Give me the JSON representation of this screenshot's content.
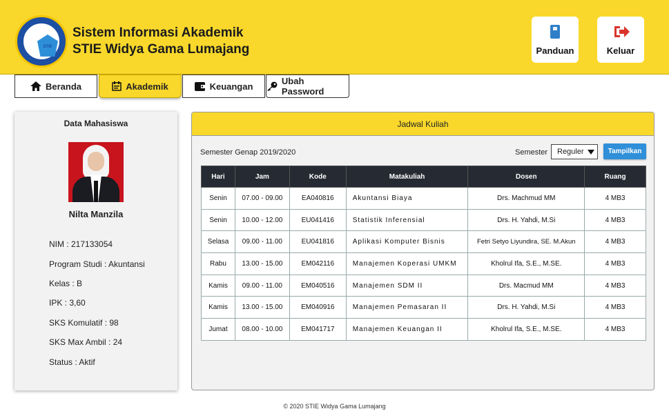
{
  "header": {
    "title_line1": "Sistem Informasi Akademik",
    "title_line2": "STIE Widya Gama Lumajang",
    "logo_text": "STIE",
    "buttons": [
      {
        "label": "Panduan",
        "icon": "book-icon"
      },
      {
        "label": "Keluar",
        "icon": "sign-out-icon"
      }
    ]
  },
  "nav": {
    "tabs": [
      {
        "label": "Beranda",
        "icon": "home-icon",
        "active": false
      },
      {
        "label": "Akademik",
        "icon": "calendar-icon",
        "active": true
      },
      {
        "label": "Keuangan",
        "icon": "wallet-icon",
        "active": false
      },
      {
        "label": "Ubah Password",
        "icon": "key-icon",
        "active": false
      }
    ]
  },
  "student": {
    "card_title": "Data Mahasiswa",
    "name": "Nilta Manzila",
    "fields": [
      "NIM : 217133054",
      "Program Studi : Akuntansi",
      "Kelas : B",
      "IPK : 3,60",
      "SKS Komulatif : 98",
      "SKS Max Ambil : 24",
      "Status : Aktif"
    ]
  },
  "schedule": {
    "title": "Jadwal Kuliah",
    "semester_text": "Semester Genap 2019/2020",
    "semester_label": "Semester",
    "semester_value": "Reguler",
    "show_button": "Tampilkan",
    "columns": [
      "Hari",
      "Jam",
      "Kode",
      "Matakuliah",
      "Dosen",
      "Ruang"
    ],
    "rows": [
      [
        "Senin",
        "07.00 - 09.00",
        "EA040816",
        "Akuntansi Biaya",
        "Drs. Machmud MM",
        "4 MB3"
      ],
      [
        "Senin",
        "10.00 - 12.00",
        "EU041416",
        "Statistik Inferensial",
        "Drs. H. Yahdi, M.Si",
        "4 MB3"
      ],
      [
        "Selasa",
        "09.00 - 11.00",
        "EU041816",
        "Aplikasi Komputer Bisnis",
        "Fetri Setyo Liyundira, SE. M.Akun",
        "4 MB3"
      ],
      [
        "Rabu",
        "13.00 - 15.00",
        "EM042116",
        "Manajemen Koperasi UMKM",
        "Kholrul Ifa, S.E., M.SE.",
        "4 MB3"
      ],
      [
        "Kamis",
        "09.00 - 11.00",
        "EM040516",
        "Manajemen SDM II",
        "Drs. Macmud MM",
        "4 MB3"
      ],
      [
        "Kamis",
        "13.00 - 15.00",
        "EM040916",
        "Manajemen Pemasaran II",
        "Drs. H. Yahdi, M.Si",
        "4 MB3"
      ],
      [
        "Jumat",
        "08.00 - 10.00",
        "EM041717",
        "Manajemen Keuangan II",
        "Kholrul Ifa, S.E., M.SE.",
        "4 MB3"
      ]
    ]
  },
  "footer": {
    "text": "2020 STIE Widya Gama Lumajang",
    "icon": "copyright-icon"
  },
  "colors": {
    "header_bg": "#f9d82b",
    "button_blue": "#2f8fd8",
    "table_head": "#262a33",
    "logout_red": "#d9342b",
    "book_blue": "#2f7fc8"
  }
}
